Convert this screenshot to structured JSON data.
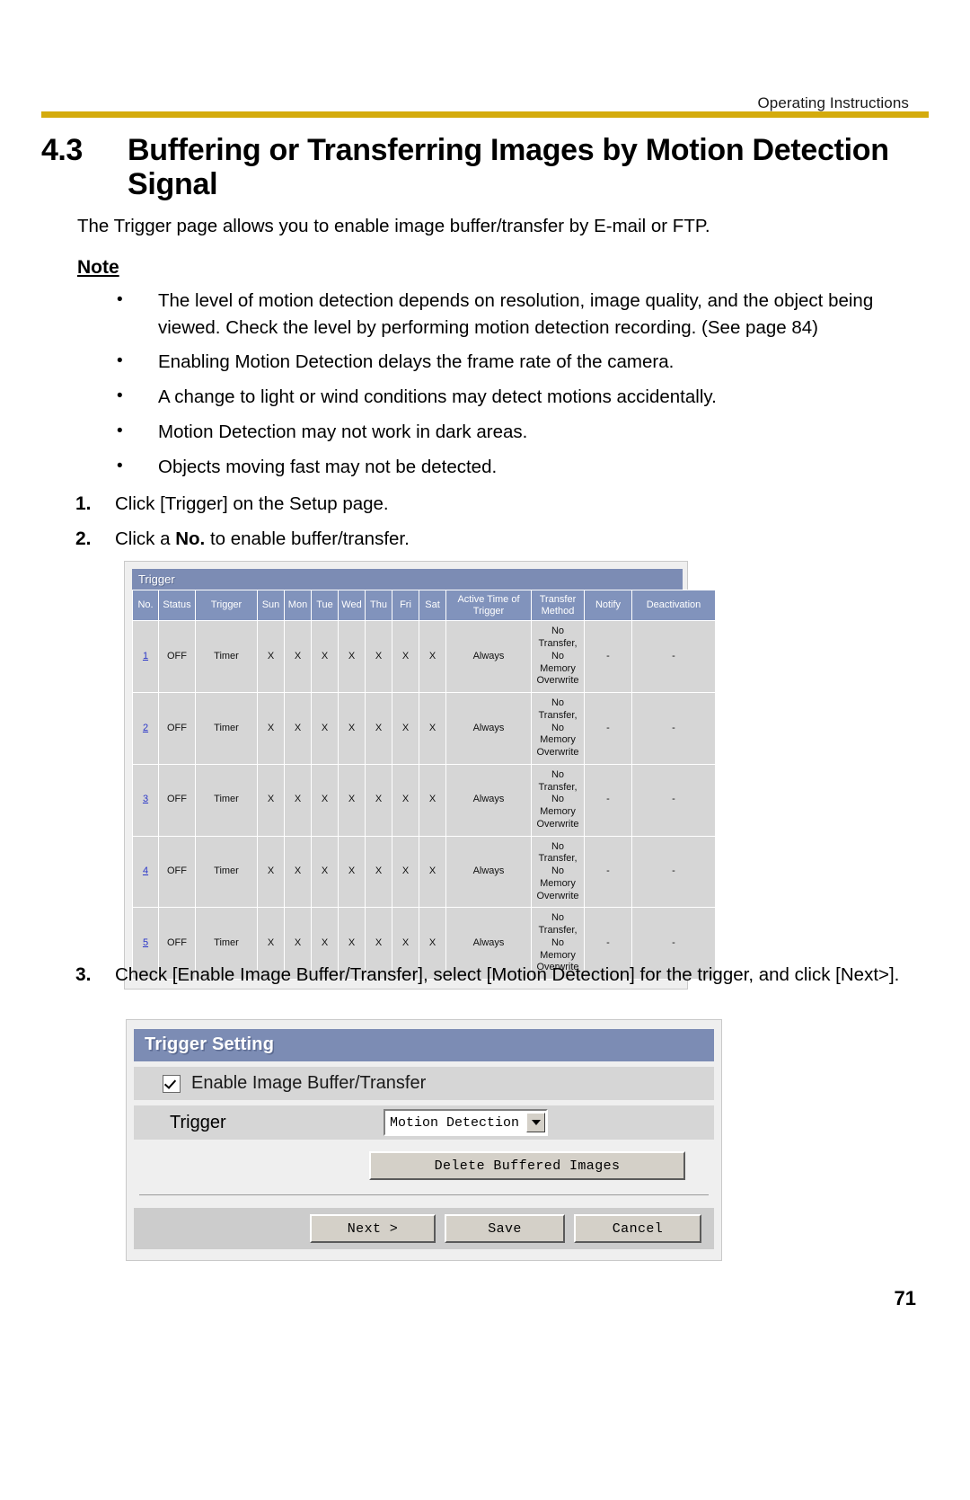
{
  "header": {
    "running_head": "Operating Instructions",
    "rule_color": "#d4ab0c"
  },
  "section": {
    "number": "4.3",
    "title": "Buffering or Transferring Images by Motion Detection Signal",
    "intro": "The Trigger page allows you to enable image buffer/transfer by E-mail or FTP."
  },
  "note": {
    "heading": "Note",
    "bullet_marker": "•",
    "items": [
      "The level of motion detection depends on resolution, image quality, and the object being viewed. Check the level by performing motion detection recording. (See page 84)",
      "Enabling Motion Detection delays the frame rate of the camera.",
      "A change to light or wind conditions may detect motions accidentally.",
      "Motion Detection may not work in dark areas.",
      "Objects moving fast may not be detected."
    ]
  },
  "steps": [
    {
      "number": "1.",
      "text": "Click [Trigger] on the Setup page."
    },
    {
      "number": "2.",
      "pre": "Click a ",
      "bold": "No.",
      "post": " to enable buffer/transfer."
    },
    {
      "number": "3.",
      "text": "Check [Enable Image Buffer/Transfer], select [Motion Detection] for the trigger, and click [Next>]."
    }
  ],
  "trigger_list": {
    "panel_title": "Trigger",
    "columns": [
      "No.",
      "Status",
      "Trigger",
      "Sun",
      "Mon",
      "Tue",
      "Wed",
      "Thu",
      "Fri",
      "Sat",
      "Active Time of Trigger",
      "Transfer Method",
      "Notify",
      "Deactivation"
    ],
    "rows": [
      {
        "no": "1",
        "status": "OFF",
        "trigger": "Timer",
        "days": [
          "X",
          "X",
          "X",
          "X",
          "X",
          "X",
          "X"
        ],
        "active_time": "Always",
        "transfer_method": "No Transfer, No Memory Overwrite",
        "notify": "-",
        "deactivation": "-"
      },
      {
        "no": "2",
        "status": "OFF",
        "trigger": "Timer",
        "days": [
          "X",
          "X",
          "X",
          "X",
          "X",
          "X",
          "X"
        ],
        "active_time": "Always",
        "transfer_method": "No Transfer, No Memory Overwrite",
        "notify": "-",
        "deactivation": "-"
      },
      {
        "no": "3",
        "status": "OFF",
        "trigger": "Timer",
        "days": [
          "X",
          "X",
          "X",
          "X",
          "X",
          "X",
          "X"
        ],
        "active_time": "Always",
        "transfer_method": "No Transfer, No Memory Overwrite",
        "notify": "-",
        "deactivation": "-"
      },
      {
        "no": "4",
        "status": "OFF",
        "trigger": "Timer",
        "days": [
          "X",
          "X",
          "X",
          "X",
          "X",
          "X",
          "X"
        ],
        "active_time": "Always",
        "transfer_method": "No Transfer, No Memory Overwrite",
        "notify": "-",
        "deactivation": "-"
      },
      {
        "no": "5",
        "status": "OFF",
        "trigger": "Timer",
        "days": [
          "X",
          "X",
          "X",
          "X",
          "X",
          "X",
          "X"
        ],
        "active_time": "Always",
        "transfer_method": "No Transfer, No Memory Overwrite",
        "notify": "-",
        "deactivation": "-"
      }
    ],
    "header_bg": "#8193bc",
    "row_bg": "#d6d6d6",
    "link_color": "#2b37c9"
  },
  "trigger_setting": {
    "panel_title": "Trigger Setting",
    "enable_label": "Enable Image Buffer/Transfer",
    "enable_checked": true,
    "trigger_label": "Trigger",
    "trigger_value": "Motion Detection",
    "delete_button": "Delete Buffered Images",
    "next_button": "Next >",
    "save_button": "Save",
    "cancel_button": "Cancel"
  },
  "page_number": "71"
}
